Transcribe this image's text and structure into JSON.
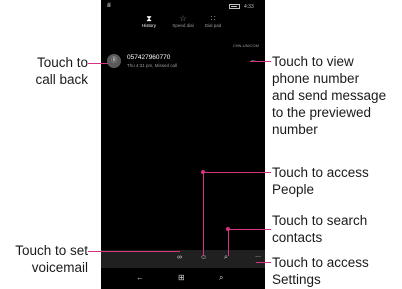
{
  "status_bar": {
    "signal": "ıl ıl",
    "time": "4:33"
  },
  "tabs": [
    {
      "icon": "⧗",
      "label": "History"
    },
    {
      "icon": "☆",
      "label": "Speed dial"
    },
    {
      "icon": "∷",
      "label": "Dial pad"
    }
  ],
  "operator": "CHN-UNICOM",
  "call": {
    "avatar": "Ⓡ",
    "number": "057427960770",
    "meta": "Thu 4:31 pm, Missed call",
    "arrow": "←"
  },
  "app_bar": {
    "voicemail_icon": "∞",
    "people_icon": "☺",
    "search_icon": "⌕",
    "more": "..."
  },
  "nav_bar": {
    "back": "←",
    "start": "⊞",
    "search": "⌕"
  },
  "annotations": {
    "call_back": [
      "Touch to",
      "call back"
    ],
    "view_number": [
      "Touch to view",
      "phone number",
      "and send message",
      "to the previewed",
      "number"
    ],
    "people": [
      "Touch to access",
      "People"
    ],
    "search": [
      "Touch to search",
      "contacts"
    ],
    "settings": [
      "Touch to access",
      "Settings"
    ],
    "voicemail": [
      "Touch to set",
      "voicemail"
    ]
  },
  "colors": {
    "annotation_line": "#d63384",
    "screen_bg": "#000000"
  }
}
